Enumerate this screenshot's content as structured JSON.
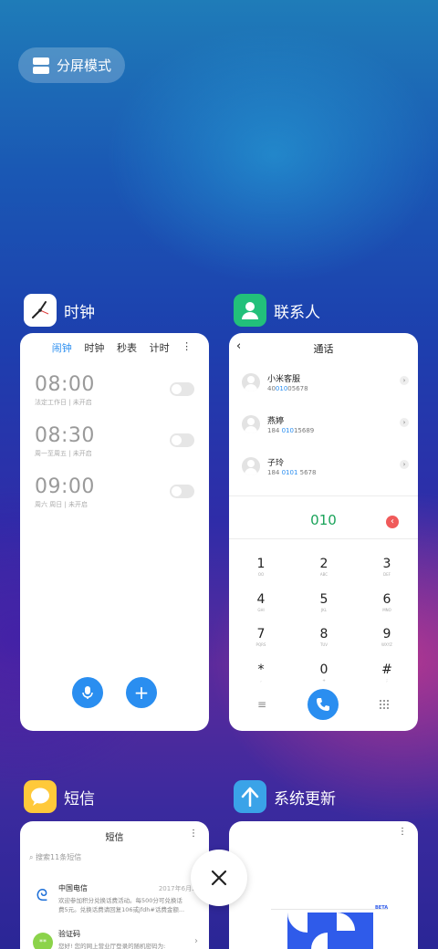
{
  "split_mode": {
    "label": "分屏模式"
  },
  "apps": {
    "clock": {
      "name": "时钟",
      "tabs": [
        "闹钟",
        "时钟",
        "秒表",
        "计时"
      ],
      "alarms": [
        {
          "time": "08:00",
          "desc": "法定工作日 | 未开启",
          "enabled": false
        },
        {
          "time": "08:30",
          "desc": "周一至周五 | 未开启",
          "enabled": false
        },
        {
          "time": "09:00",
          "desc": "周六 周日 | 未开启",
          "enabled": false
        }
      ],
      "mic_icon": "mic-icon",
      "add_label": "+"
    },
    "contacts": {
      "name": "联系人",
      "title": "通话",
      "contacts": [
        {
          "name": "小米客服",
          "num_pre": "40",
          "num_hl": "010",
          "num_post": "05678"
        },
        {
          "name": "燕婷",
          "num_pre": "184 ",
          "num_hl": "010",
          "num_post": "15689"
        },
        {
          "name": "子玲",
          "num_pre": "184 ",
          "num_hl": "0101",
          "num_post": " 5678"
        }
      ],
      "dialed": "010",
      "keys": [
        {
          "d": "1",
          "l": "OO"
        },
        {
          "d": "2",
          "l": "ABC"
        },
        {
          "d": "3",
          "l": "DEF"
        },
        {
          "d": "4",
          "l": "GHI"
        },
        {
          "d": "5",
          "l": "JKL"
        },
        {
          "d": "6",
          "l": "MNO"
        },
        {
          "d": "7",
          "l": "PQRS"
        },
        {
          "d": "8",
          "l": "TUV"
        },
        {
          "d": "9",
          "l": "WXYZ"
        },
        {
          "d": "*",
          "l": ","
        },
        {
          "d": "0",
          "l": "+"
        },
        {
          "d": "#",
          "l": ";"
        }
      ]
    },
    "messages": {
      "name": "短信",
      "title": "短信",
      "search_placeholder": "搜索11条短信",
      "items": [
        {
          "sender": "中国电信",
          "date": "2017年6月30",
          "line1": "欢迎参加积分兑换话费活动。每500分可兑换话",
          "line2": "费5元。兑换话费请回复106或jfdh#话费金额..."
        },
        {
          "sender": "验证码",
          "date": "",
          "line1": "您好! 您的网上营业厅登录的随机密码为:",
          "line2": ""
        }
      ]
    },
    "updater": {
      "name": "系统更新",
      "badge": "BETA"
    }
  },
  "colors": {
    "accent_blue": "#2a8ef0",
    "dial_green": "#1aa35a",
    "delete_red": "#f05a5a"
  }
}
